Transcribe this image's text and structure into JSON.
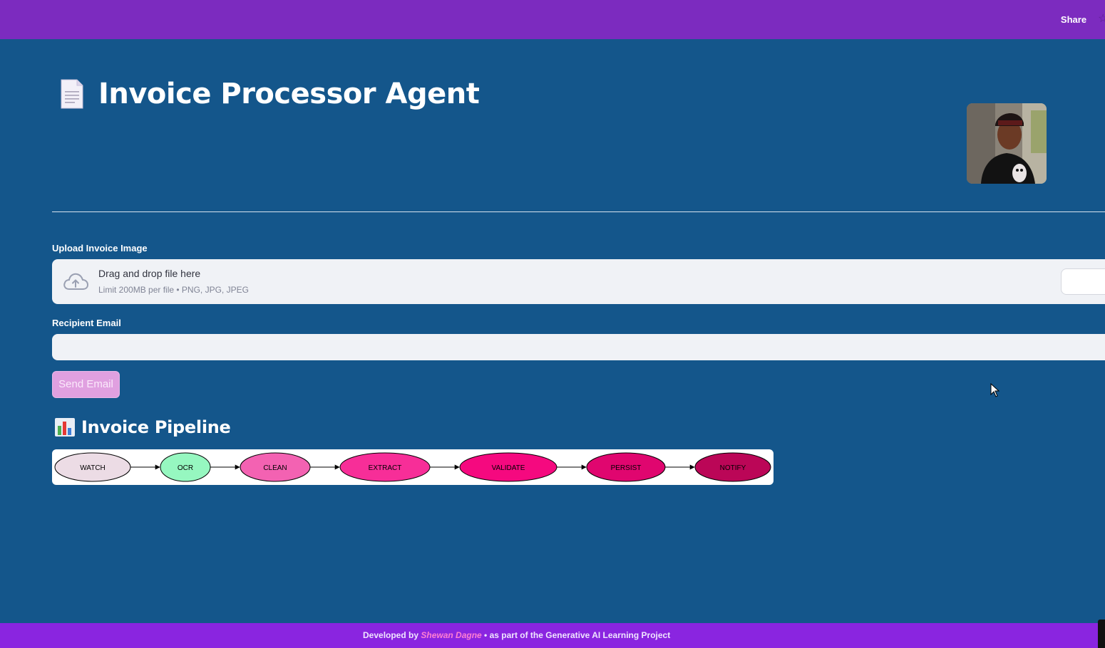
{
  "header": {
    "share_label": "Share"
  },
  "main": {
    "title": "Invoice Processor Agent",
    "upload": {
      "label": "Upload Invoice Image",
      "drop_text": "Drag and drop file here",
      "limit_text": "Limit 200MB per file • PNG, JPG, JPEG"
    },
    "email": {
      "label": "Recipient Email",
      "value": ""
    },
    "send_label": "Send Email",
    "pipeline_title": "Invoice Pipeline",
    "pipeline": {
      "nodes": [
        {
          "label": "WATCH",
          "color": "#ecdce5"
        },
        {
          "label": "OCR",
          "color": "#96f7c0"
        },
        {
          "label": "CLEAN",
          "color": "#f362b2"
        },
        {
          "label": "EXTRACT",
          "color": "#f72e98"
        },
        {
          "label": "VALIDATE",
          "color": "#f5097f"
        },
        {
          "label": "PERSIST",
          "color": "#e0066f"
        },
        {
          "label": "NOTIFY",
          "color": "#bb0657"
        }
      ]
    }
  },
  "footer": {
    "prefix": "Developed by ",
    "author": "Shewan Dagne",
    "suffix": " • as part of the Generative AI Learning Project"
  },
  "icons": {
    "document": "document-icon",
    "avatar": "avatar",
    "cloud_upload": "cloud-upload-icon",
    "bar_chart": "bar-chart-icon",
    "star": "star-icon"
  }
}
